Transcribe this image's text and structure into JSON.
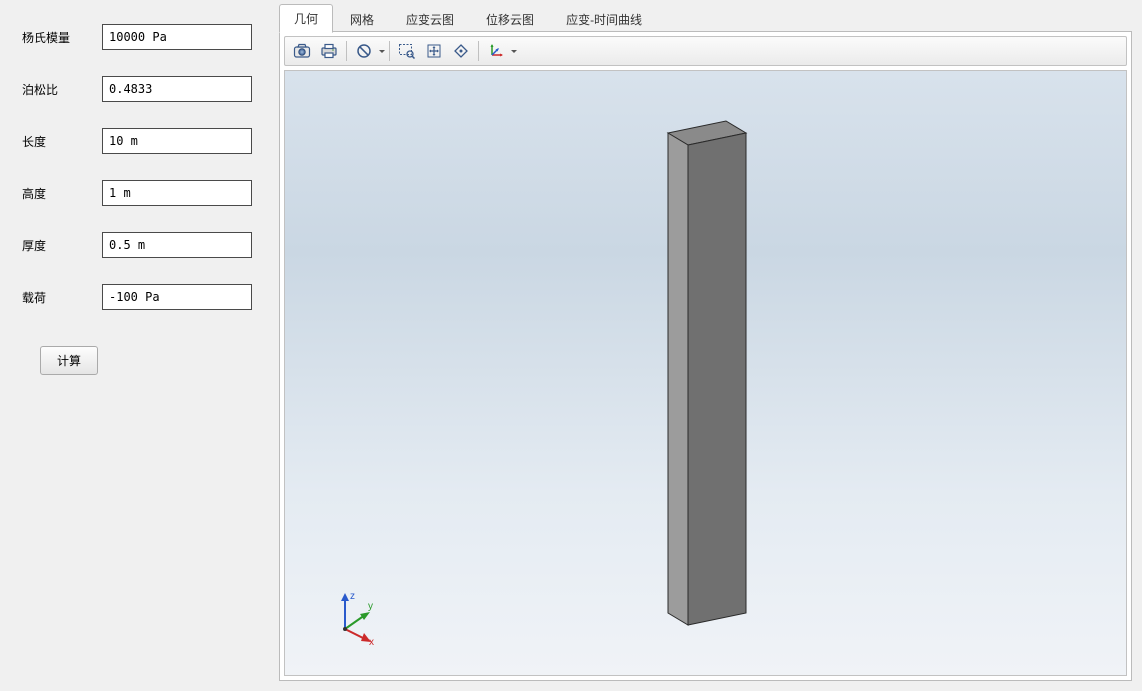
{
  "form": {
    "youngs_modulus_label": "杨氏模量",
    "youngs_modulus_value": "10000 Pa",
    "poisson_label": "泊松比",
    "poisson_value": "0.4833",
    "length_label": "长度",
    "length_value": "10 m",
    "height_label": "高度",
    "height_value": "1 m",
    "thickness_label": "厚度",
    "thickness_value": "0.5 m",
    "load_label": "载荷",
    "load_value": "-100 Pa",
    "compute_label": "计算"
  },
  "tabs": {
    "t0": "几何",
    "t1": "网格",
    "t2": "应变云图",
    "t3": "位移云图",
    "t4": "应变-时间曲线"
  },
  "triad": {
    "x": "x",
    "y": "y",
    "z": "z"
  }
}
